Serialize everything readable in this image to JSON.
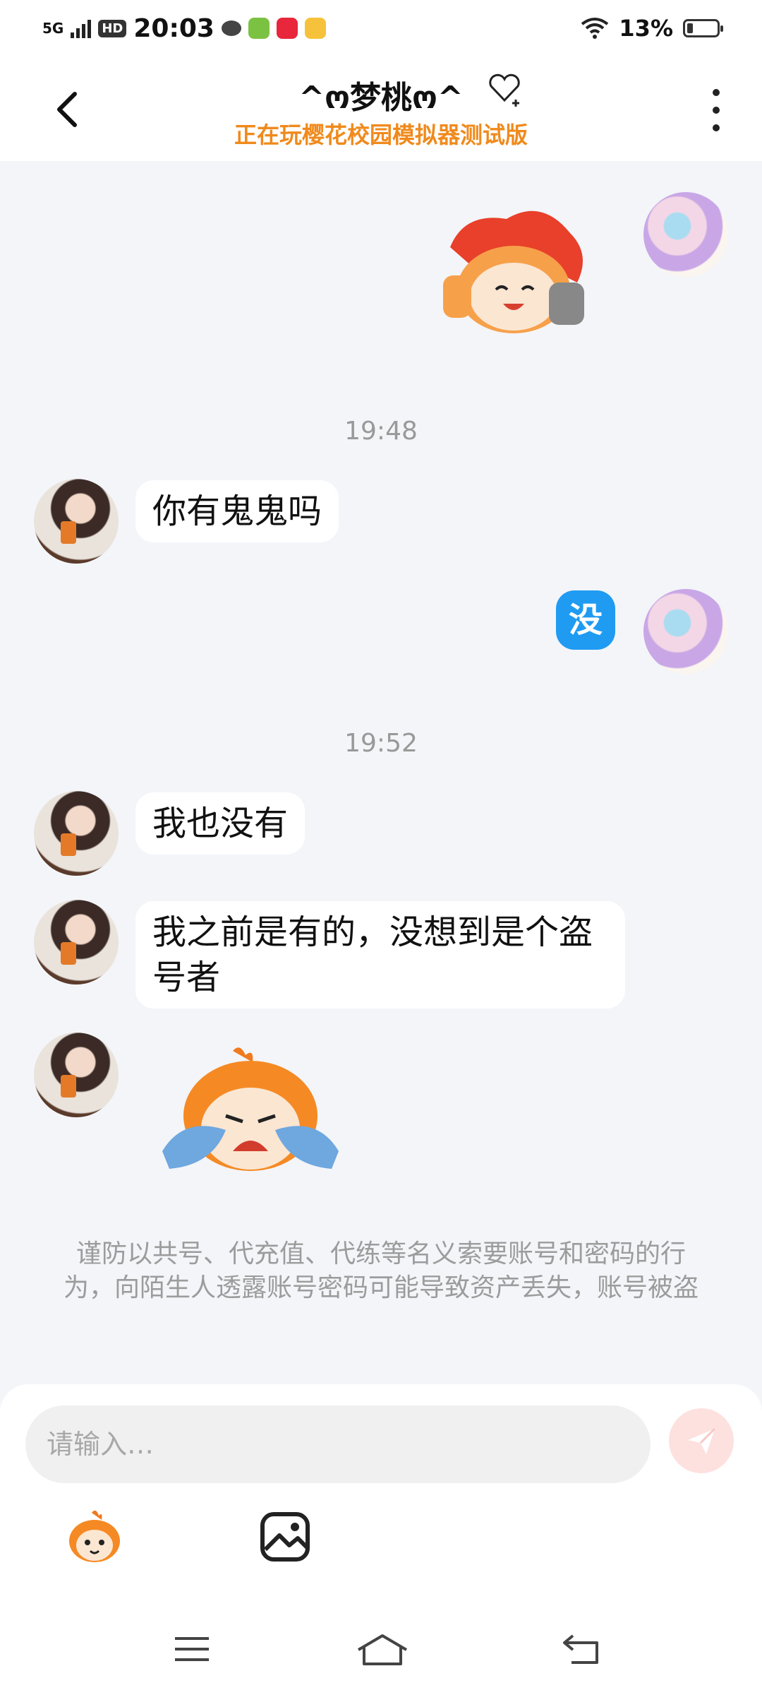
{
  "status_bar": {
    "network": "5G",
    "hd_badge": "HD",
    "time": "20:03",
    "battery": "13%"
  },
  "header": {
    "title": "^ო梦桃ო^",
    "subtitle": "正在玩樱花校园模拟器测试版"
  },
  "messages": {
    "time_1": "19:48",
    "peer_1": "你有鬼鬼吗",
    "me_1": "没",
    "time_2": "19:52",
    "peer_2": "我也没有",
    "peer_3": "我之前是有的，没想到是个盗号者"
  },
  "warning": "谨防以共号、代充值、代练等名义索要账号和密码的行为，向陌生人透露账号密码可能导致资产丢失，账号被盗",
  "composer": {
    "placeholder": "请输入…"
  },
  "colors": {
    "accent_orange": "#f08a1c",
    "my_bubble": "#1f9bf2",
    "send_button": "#fde1df"
  },
  "icons": [
    "back-arrow-icon",
    "heart-icon",
    "more-icon",
    "send-icon",
    "emoji-sticker-icon",
    "image-icon",
    "menu-icon",
    "home-icon",
    "back-nav-icon"
  ]
}
